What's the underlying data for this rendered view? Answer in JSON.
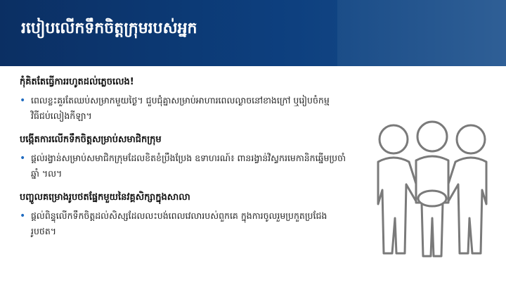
{
  "header": {
    "title": "របៀបលើកទឹកចិត្តក្រុមរបស់អ្នក"
  },
  "sections": [
    {
      "heading": "កុំគិតតែធ្វើការរហូតដល់ភ្លេចលេង!",
      "bullet": "ពេលខ្លះគួរតែឈប់សម្រាកមួយថ្ងៃ។ ជួបជុំគ្នាសម្រាប់អាហារពេលល្ងាចនៅខាងក្រៅ ឬរៀបចំកម្មវិធីជប់លៀងកីឡា។"
    },
    {
      "heading": "បង្កើតការលើកទឹកចិត្តសម្រាប់សមាជិកក្រុម",
      "bullet": "ផ្តល់រង្វាន់សម្រាប់សមាជិកក្រុមដែលខិតខំប្រឹងប្រែង ឧទាហរណ៍៖ ពានរង្វាន់វិស្វករមេកានិកឆ្នើមប្រចាំឆ្នាំ ។ល។"
    },
    {
      "heading": "បញ្ចូលគម្រោងរូបថតផ្នែកមួយនៃវគ្គសិក្សាក្នុងសាលា",
      "bullet": "ផ្តល់ពិន្ទុលើកទឹកចិត្តដល់សិស្សដែលលះបង់ពេលវេលារបស់ពួកគេ ក្នុងការចូលរួមប្រកួតប្រជែងរូបថត។"
    }
  ],
  "colors": {
    "header_dark": "#0b2f63",
    "bullet_accent": "#1f6bc0",
    "figure_stroke": "#7a7a7a"
  },
  "illustration": {
    "icon": "teamwork-hands-together-icon"
  }
}
